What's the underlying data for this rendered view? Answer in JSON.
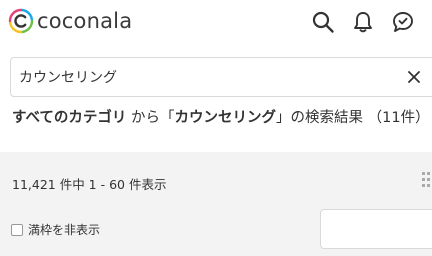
{
  "header": {
    "logo_text": "coconala",
    "icons": [
      "search-icon",
      "bell-icon",
      "chat-icon"
    ]
  },
  "search": {
    "value": "カウンセリング",
    "placeholder": ""
  },
  "result": {
    "category": "すべてのカテゴリ",
    "from": " から「",
    "keyword": "カウンセリング",
    "suffix": "」の検索結果 （11件）"
  },
  "listing": {
    "count_text": "11,421 件中 1 - 60 件表示",
    "filter_label": "満枠を非表示",
    "filter_checked": false,
    "sort_value": ""
  },
  "colors": {
    "brand_blue": "#1aa9e6",
    "brand_green": "#6cc04a",
    "brand_yellow": "#f7c325",
    "brand_pink": "#e8407a",
    "band_gray": "#f3f3f3"
  }
}
